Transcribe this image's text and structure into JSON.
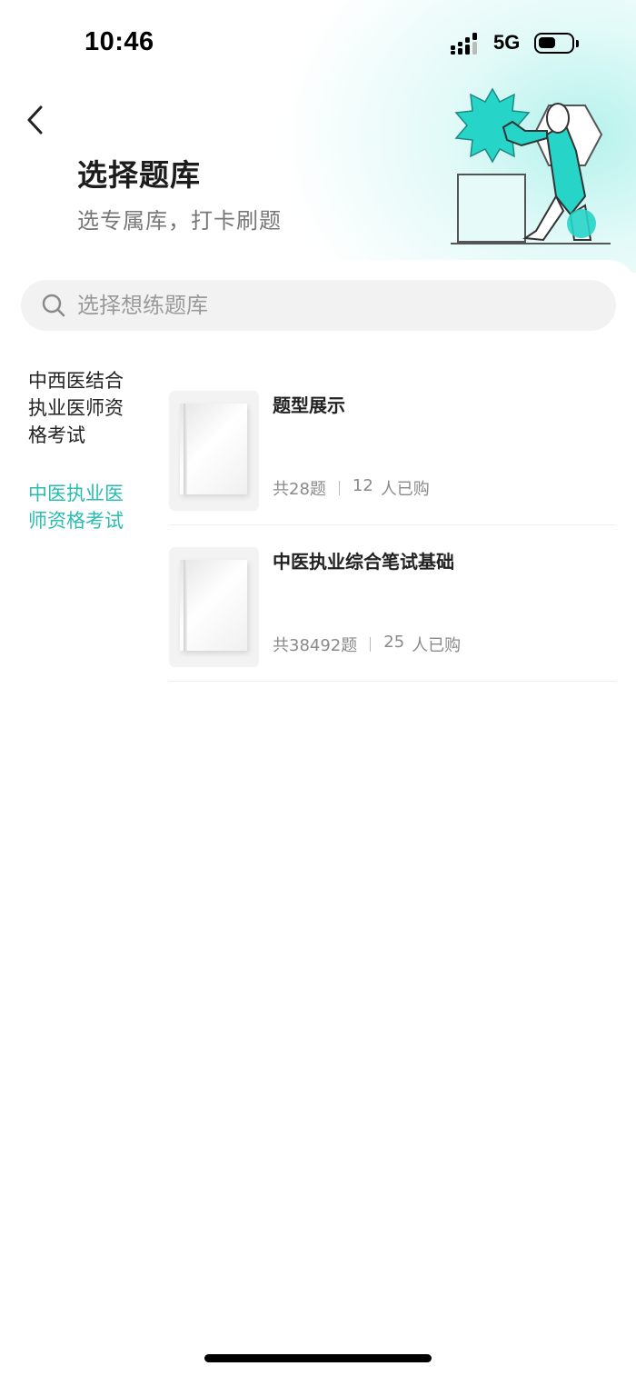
{
  "status_bar": {
    "time": "10:46",
    "network": "5G"
  },
  "header": {
    "title": "选择题库",
    "subtitle": "选专属库，打卡刷题",
    "accent_color": "#2bbcb0"
  },
  "search": {
    "placeholder": "选择想练题库"
  },
  "categories": [
    {
      "label": "中西医结合执业医师资格考试",
      "active": false
    },
    {
      "label": "中医执业医师资格考试",
      "active": true
    }
  ],
  "banks": [
    {
      "title": "题型展示",
      "count": "共28题",
      "buyers_num": "12",
      "buyers_text": "人已购"
    },
    {
      "title": "中医执业综合笔试基础",
      "count": "共38492题",
      "buyers_num": "25",
      "buyers_text": "人已购"
    }
  ]
}
